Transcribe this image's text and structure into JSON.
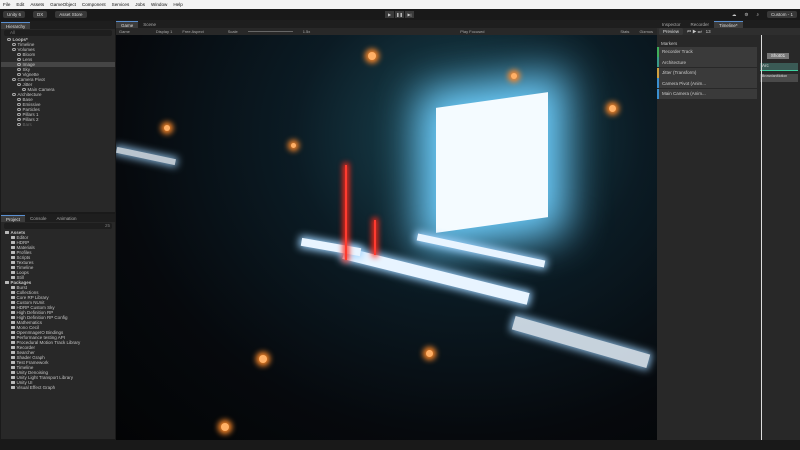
{
  "menu": [
    "File",
    "Edit",
    "Assets",
    "GameObject",
    "Component",
    "Services",
    "Jobs",
    "Window",
    "Help"
  ],
  "toolbar": {
    "account": "Unity 6",
    "branch": "DX",
    "asset_store": "Asset Store",
    "layout": "Custom - 1"
  },
  "play_controls": [
    "play-icon",
    "pause-icon",
    "step-icon"
  ],
  "hierarchy": {
    "tab": "Hierarchy",
    "search_placeholder": "All",
    "items": [
      {
        "label": "Loops*",
        "depth": 0,
        "bold": true
      },
      {
        "label": "Timeline",
        "depth": 1
      },
      {
        "label": "Volumes",
        "depth": 1
      },
      {
        "label": "Bloom",
        "depth": 2
      },
      {
        "label": "Lens",
        "depth": 2
      },
      {
        "label": "Image",
        "depth": 2,
        "selected": true
      },
      {
        "label": "Sky",
        "depth": 2
      },
      {
        "label": "Vignette",
        "depth": 2
      },
      {
        "label": "Camera Pivot",
        "depth": 1
      },
      {
        "label": "Jitter",
        "depth": 2
      },
      {
        "label": "Main Camera",
        "depth": 3
      },
      {
        "label": "Architecture",
        "depth": 1
      },
      {
        "label": "Base",
        "depth": 2
      },
      {
        "label": "Emissive",
        "depth": 2
      },
      {
        "label": "Particles",
        "depth": 2
      },
      {
        "label": "Pillars 1",
        "depth": 2
      },
      {
        "label": "Pillars 2",
        "depth": 2
      },
      {
        "label": "Bars",
        "depth": 2,
        "dim": true
      }
    ]
  },
  "project": {
    "tabs": [
      "Project",
      "Console",
      "Animation"
    ],
    "count": "25",
    "assets_header": "Assets",
    "assets": [
      "Editor",
      "HDRP",
      "Materials",
      "Profiles",
      "Scripts",
      "Textures",
      "Timeline",
      "Loops",
      "Still"
    ],
    "packages_header": "Packages",
    "packages": [
      "Burst",
      "Collections",
      "Core RP Library",
      "Custom NUnit",
      "HDRP Custom Sky",
      "High Definition RP",
      "High Definition RP Config",
      "Mathematics",
      "Mono Cecil",
      "OpenImageIO Bindings",
      "Performance testing API",
      "Procedural Motion Track Library",
      "Recorder",
      "Searcher",
      "Shader Graph",
      "Test Framework",
      "Timeline",
      "Unity Denoising",
      "Unity Light Transport Library",
      "Unity UI",
      "Visual Effect Graph"
    ]
  },
  "game": {
    "tabs": [
      "Game",
      "Scene"
    ],
    "mode": "Game",
    "display": "Display 1",
    "aspect": "Free Aspect",
    "scale_label": "Scale",
    "scale": "1.5x",
    "play_mode": "Play Focused",
    "stats": "Stats",
    "gizmos": "Gizmos"
  },
  "right": {
    "tabs": [
      "Inspector",
      "Recorder",
      "Timeline*"
    ],
    "preview": "Preview",
    "frame": "13",
    "markers": "Markers",
    "tracks": [
      {
        "label": "Recorder Track",
        "color": "#3fae5a"
      },
      {
        "label": "Architecture",
        "color": "#3a9a8a"
      },
      {
        "label": "Jitter (Transform)",
        "color": "#d0a040"
      },
      {
        "label": "Camera Pivot (Anim...",
        "color": "#3a8fd0"
      },
      {
        "label": "Main Camera (Anim...",
        "color": "#3a8fd0"
      }
    ],
    "clips": {
      "recorder": "Shot01",
      "architecture": "Arc",
      "jitter": "BrownianMotion"
    }
  },
  "colors": {
    "accent": "#5a8fd0",
    "bg": "#282828"
  }
}
